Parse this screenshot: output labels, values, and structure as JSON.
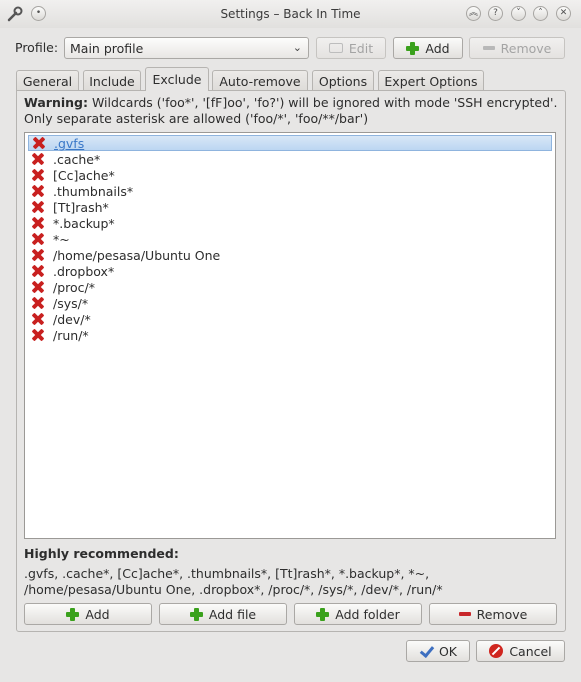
{
  "window": {
    "title": "Settings – Back In Time"
  },
  "titlebar_buttons": [
    {
      "name": "shade-up-icon",
      "glyph": "︽"
    },
    {
      "name": "help-icon",
      "glyph": "?"
    },
    {
      "name": "minimize-icon",
      "glyph": "˅"
    },
    {
      "name": "maximize-icon",
      "glyph": "˄"
    },
    {
      "name": "close-icon",
      "glyph": "✕"
    }
  ],
  "profile": {
    "label": "Profile:",
    "selected": "Main profile",
    "edit_label": "Edit",
    "add_label": "Add",
    "remove_label": "Remove"
  },
  "tabs": [
    {
      "label": "General"
    },
    {
      "label": "Include"
    },
    {
      "label": "Exclude",
      "active": true
    },
    {
      "label": "Auto-remove"
    },
    {
      "label": "Options"
    },
    {
      "label": "Expert Options"
    }
  ],
  "exclude": {
    "warning_bold": "Warning:",
    "warning_text": " Wildcards ('foo*', '[fF]oo', 'fo?') will be ignored with mode 'SSH encrypted'. Only separate asterisk are allowed ('foo/*', 'foo/**/bar')",
    "items": [
      ".gvfs",
      ".cache*",
      "[Cc]ache*",
      ".thumbnails*",
      "[Tt]rash*",
      "*.backup*",
      "*~",
      "/home/pesasa/Ubuntu One",
      ".dropbox*",
      "/proc/*",
      "/sys/*",
      "/dev/*",
      "/run/*"
    ],
    "selected_index": 0,
    "recommended_title": "Highly recommended:",
    "recommended_text": ".gvfs, .cache*, [Cc]ache*, .thumbnails*, [Tt]rash*, *.backup*, *~, /home/pesasa/Ubuntu One, .dropbox*, /proc/*, /sys/*, /dev/*, /run/*",
    "add_label": "Add",
    "add_file_label": "Add file",
    "add_folder_label": "Add folder",
    "remove_label": "Remove"
  },
  "dialog": {
    "ok_label": "OK",
    "cancel_label": "Cancel"
  },
  "colors": {
    "accent": "#3a78c8",
    "add_green": "#3aa11c",
    "remove_red": "#c8272b"
  }
}
